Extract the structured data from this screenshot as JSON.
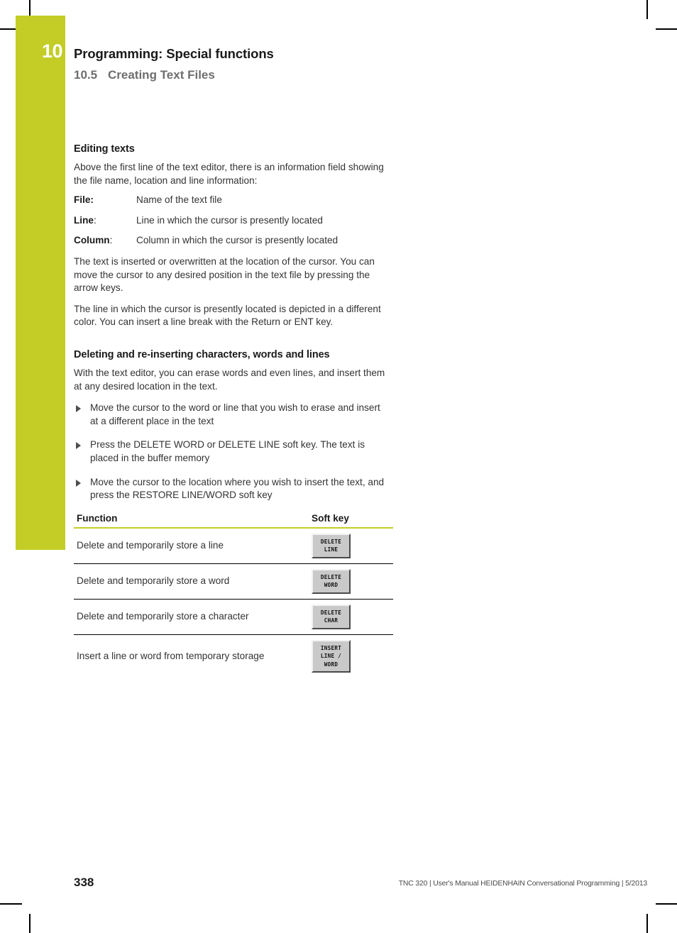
{
  "crop_marks": {
    "visible": true
  },
  "chapter": {
    "number": "10",
    "tab_color": "#c3cd26"
  },
  "running_head": {
    "title": "Programming: Special functions",
    "section_number": "10.5",
    "section_title": "Creating Text Files",
    "title_color": "#1a1a1a",
    "subtitle_color": "#6e6e6e"
  },
  "content": {
    "heading_1": "Editing texts",
    "intro_paragraph": "Above the first line of the text editor, there is an information field showing the file name, location and line information:",
    "definitions": [
      {
        "term": "File",
        "colon_bold": true,
        "description": "Name of the text file"
      },
      {
        "term": "Line",
        "colon_bold": false,
        "description": "Line in which the cursor is presently located"
      },
      {
        "term": "Column",
        "colon_bold": false,
        "description": "Column in which the cursor is presently located"
      }
    ],
    "paragraph_2": "The text is inserted or overwritten at the location of the cursor. You can move the cursor to any desired position in the text file by pressing the arrow keys.",
    "paragraph_3": "The line in which the cursor is presently located is depicted in a different color. You can insert a line break with the Return or ENT key.",
    "heading_2": "Deleting and re-inserting characters, words and lines",
    "paragraph_4": "With the text editor, you can erase words and even lines, and insert them at any desired location in the text.",
    "bullets": [
      "Move the cursor to the word or line that you wish to erase and insert at a different place in the text",
      "Press the DELETE WORD or DELETE LINE soft key. The text is placed in the buffer memory",
      "Move the cursor to the location where you wish to insert the text, and press the RESTORE LINE/WORD soft key"
    ]
  },
  "softkey_table": {
    "headers": [
      "Function",
      "Soft key"
    ],
    "header_rule_color": "#c3cd26",
    "rows": [
      {
        "function": "Delete and temporarily store a line",
        "softkey_lines": [
          "DELETE",
          "LINE"
        ]
      },
      {
        "function": "Delete and temporarily store a word",
        "softkey_lines": [
          "DELETE",
          "WORD"
        ]
      },
      {
        "function": "Delete and temporarily store a character",
        "softkey_lines": [
          "DELETE",
          "CHAR"
        ]
      },
      {
        "function": "Insert a line or word from temporary storage",
        "softkey_lines": [
          "INSERT",
          "LINE /",
          "WORD"
        ]
      }
    ]
  },
  "footer": {
    "page_number": "338",
    "note": "TNC 320 | User's Manual HEIDENHAIN Conversational Programming | 5/2013"
  }
}
